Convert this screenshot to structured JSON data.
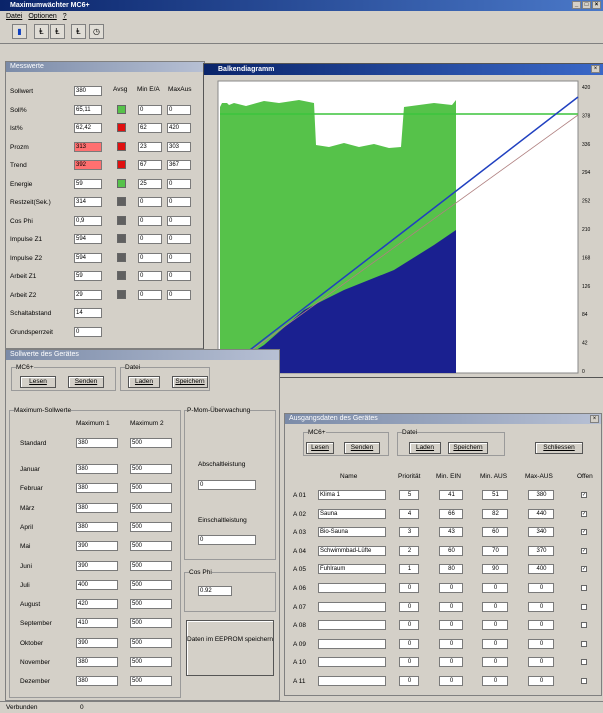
{
  "window": {
    "title": "Maximumwächter MC6+"
  },
  "menu": [
    "Datei",
    "Optionen",
    "?"
  ],
  "messwerte": {
    "title": "Messwerte",
    "headers": {
      "c1": "Avsg",
      "c2": "Min E/A",
      "c3": "MaxAus"
    },
    "rows": [
      {
        "label": "Sollwert",
        "value": "380",
        "ind": "",
        "c2": "",
        "c3": ""
      },
      {
        "label": "Soll%",
        "value": "65,11",
        "ind": "g",
        "c2": "0",
        "c3": "0"
      },
      {
        "label": "Ist%",
        "value": "62,42",
        "ind": "r",
        "c2": "62",
        "c3": "420"
      },
      {
        "label": "Prozm",
        "value": "313",
        "ind": "r",
        "c2": "23",
        "c3": "303",
        "red": true
      },
      {
        "label": "Trend",
        "value": "392",
        "ind": "r",
        "c2": "67",
        "c3": "367",
        "red": true
      },
      {
        "label": "Energie",
        "value": "59",
        "ind": "g",
        "c2": "25",
        "c3": "0"
      },
      {
        "label": "Restzeit(Sek.)",
        "value": "314",
        "ind": "d",
        "c2": "0",
        "c3": "0"
      },
      {
        "label": "Cos Phi",
        "value": "0,9",
        "ind": "d",
        "c2": "0",
        "c3": "0"
      },
      {
        "label": "Impulse Z1",
        "value": "594",
        "ind": "d",
        "c2": "0",
        "c3": "0"
      },
      {
        "label": "Impulse Z2",
        "value": "594",
        "ind": "d",
        "c2": "0",
        "c3": "0"
      },
      {
        "label": "Arbeit Z1",
        "value": "59",
        "ind": "d",
        "c2": "0",
        "c3": "0"
      },
      {
        "label": "Arbeit Z2",
        "value": "29",
        "ind": "d",
        "c2": "0",
        "c3": "0"
      },
      {
        "label": "Schaltabstand",
        "value": "14",
        "ind": "",
        "c2": "",
        "c3": ""
      },
      {
        "label": "Grundsperrzeit",
        "value": "0",
        "ind": "",
        "c2": "",
        "c3": ""
      }
    ]
  },
  "chart": {
    "title": "Balkendiagramm",
    "yticks": [
      "420",
      "378",
      "336",
      "294",
      "252",
      "210",
      "168",
      "126",
      "84",
      "42",
      "0"
    ]
  },
  "sollwerte": {
    "title": "Sollwerte des Gerätes",
    "group_mc": "MC6+",
    "group_datei": "Datei",
    "btn_lesen": "Lesen",
    "btn_senden": "Senden",
    "btn_laden": "Laden",
    "btn_speichern": "Speichern",
    "group_max": "Maximum-Sollwerte",
    "col1": "Maximum 1",
    "col2": "Maximum 2",
    "rows": [
      {
        "label": "Standard",
        "v1": "380",
        "v2": "500"
      },
      {
        "label": "Januar",
        "v1": "380",
        "v2": "500"
      },
      {
        "label": "Februar",
        "v1": "380",
        "v2": "500"
      },
      {
        "label": "März",
        "v1": "380",
        "v2": "500"
      },
      {
        "label": "April",
        "v1": "380",
        "v2": "500"
      },
      {
        "label": "Mai",
        "v1": "390",
        "v2": "500"
      },
      {
        "label": "Juni",
        "v1": "390",
        "v2": "500"
      },
      {
        "label": "Juli",
        "v1": "400",
        "v2": "500"
      },
      {
        "label": "August",
        "v1": "420",
        "v2": "500"
      },
      {
        "label": "September",
        "v1": "410",
        "v2": "500"
      },
      {
        "label": "Oktober",
        "v1": "390",
        "v2": "500"
      },
      {
        "label": "November",
        "v1": "380",
        "v2": "500"
      },
      {
        "label": "Dezember",
        "v1": "380",
        "v2": "500"
      }
    ],
    "pmom": "P-Mom-Überwachung",
    "abschalt_label": "Abschaltleistung",
    "abschalt_value": "0",
    "einschalt_label": "Einschaltleistung",
    "einschalt_value": "0",
    "cosphi_label": "Cos Phi",
    "cosphi_value": "0.92",
    "eeprom_btn": "Daten im EEPROM speichern"
  },
  "ausgang": {
    "title": "Ausgangsdaten des Gerätes",
    "group_mc": "MC6+",
    "group_datei": "Datei",
    "btn_lesen": "Lesen",
    "btn_senden": "Senden",
    "btn_laden": "Laden",
    "btn_speichern": "Speichern",
    "btn_schliessen": "Schliessen",
    "headers": {
      "name": "Name",
      "prio": "Priorität",
      "minein": "Min. EIN",
      "minaus": "Min. AUS",
      "maxaus": "Max-AUS",
      "offen": "Offen"
    },
    "rows": [
      {
        "id": "A 01",
        "name": "Klima 1",
        "prio": "5",
        "minein": "41",
        "minaus": "51",
        "maxaus": "380",
        "offen": true
      },
      {
        "id": "A 02",
        "name": "Sauna",
        "prio": "4",
        "minein": "66",
        "minaus": "82",
        "maxaus": "440",
        "offen": true
      },
      {
        "id": "A 03",
        "name": "Bio-Sauna",
        "prio": "3",
        "minein": "43",
        "minaus": "60",
        "maxaus": "340",
        "offen": true
      },
      {
        "id": "A 04",
        "name": "Schwimmbad-Lüfte",
        "prio": "2",
        "minein": "60",
        "minaus": "70",
        "maxaus": "370",
        "offen": true
      },
      {
        "id": "A 05",
        "name": "Fuhlraum",
        "prio": "1",
        "minein": "80",
        "minaus": "90",
        "maxaus": "400",
        "offen": true
      },
      {
        "id": "A 06",
        "name": "",
        "prio": "0",
        "minein": "0",
        "minaus": "0",
        "maxaus": "0",
        "offen": false
      },
      {
        "id": "A 07",
        "name": "",
        "prio": "0",
        "minein": "0",
        "minaus": "0",
        "maxaus": "0",
        "offen": false
      },
      {
        "id": "A 08",
        "name": "",
        "prio": "0",
        "minein": "0",
        "minaus": "0",
        "maxaus": "0",
        "offen": false
      },
      {
        "id": "A 09",
        "name": "",
        "prio": "0",
        "minein": "0",
        "minaus": "0",
        "maxaus": "0",
        "offen": false
      },
      {
        "id": "A 10",
        "name": "",
        "prio": "0",
        "minein": "0",
        "minaus": "0",
        "maxaus": "0",
        "offen": false
      },
      {
        "id": "A 11",
        "name": "",
        "prio": "0",
        "minein": "0",
        "minaus": "0",
        "maxaus": "0",
        "offen": false
      }
    ]
  },
  "status": {
    "text": "Verbunden",
    "value": "0"
  },
  "colors": {
    "green": "#56c24a",
    "navy": "#1a2090",
    "line_green": "#3cc43c",
    "line_blue": "#2040c0"
  }
}
